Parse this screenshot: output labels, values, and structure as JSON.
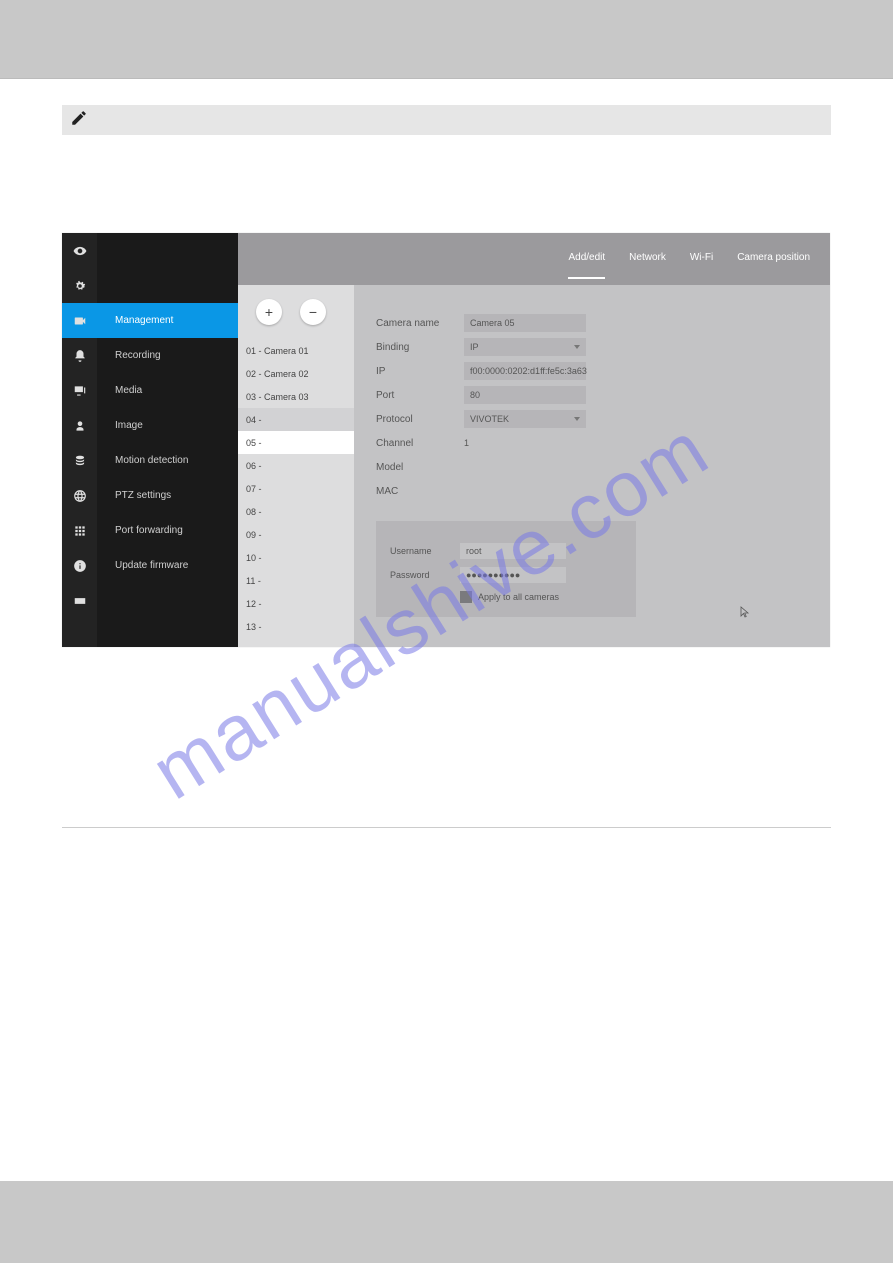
{
  "sidebar": {
    "items": [
      {
        "label": "Management",
        "active": true
      },
      {
        "label": "Recording"
      },
      {
        "label": "Media"
      },
      {
        "label": "Image"
      },
      {
        "label": "Motion detection"
      },
      {
        "label": "PTZ settings"
      },
      {
        "label": "Port forwarding"
      },
      {
        "label": "Update firmware"
      }
    ]
  },
  "tabs": {
    "items": [
      "Add/edit",
      "Network",
      "Wi-Fi",
      "Camera position"
    ],
    "active": "Add/edit"
  },
  "cam_list": {
    "add": "+",
    "remove": "−",
    "rows": [
      {
        "label": "01 - Camera 01"
      },
      {
        "label": "02 - Camera 02"
      },
      {
        "label": "03 - Camera 03"
      },
      {
        "label": "04 -"
      },
      {
        "label": "05 -",
        "sel": true
      },
      {
        "label": "06 -"
      },
      {
        "label": "07 -"
      },
      {
        "label": "08 -"
      },
      {
        "label": "09 -"
      },
      {
        "label": "10 -"
      },
      {
        "label": "11 -"
      },
      {
        "label": "12 -"
      },
      {
        "label": "13 -"
      }
    ]
  },
  "form": {
    "camera_name": {
      "label": "Camera name",
      "value": "Camera 05"
    },
    "binding": {
      "label": "Binding",
      "value": "IP"
    },
    "ip": {
      "label": "IP",
      "value": "f00:0000:0202:d1ff:fe5c:3a63"
    },
    "port": {
      "label": "Port",
      "value": "80"
    },
    "protocol": {
      "label": "Protocol",
      "value": "VIVOTEK"
    },
    "channel": {
      "label": "Channel",
      "value": "1"
    },
    "model": {
      "label": "Model",
      "value": ""
    },
    "mac": {
      "label": "MAC",
      "value": ""
    }
  },
  "cred": {
    "username": {
      "label": "Username",
      "value": "root"
    },
    "password": {
      "label": "Password",
      "value": "●●●●●●●●●●"
    },
    "apply": {
      "label": "Apply to all cameras"
    }
  },
  "watermark": "manualshive.com"
}
